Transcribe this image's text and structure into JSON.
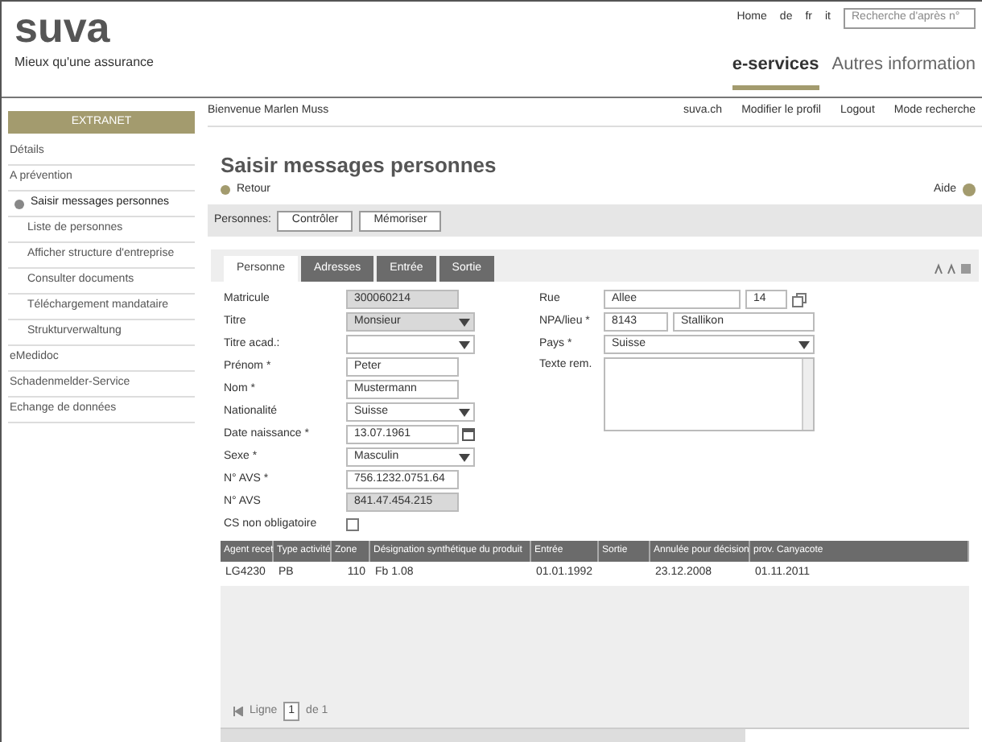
{
  "header": {
    "logo": "suva",
    "tagline": "Mieux qu'une assurance",
    "top_links": [
      "Home",
      "de",
      "fr",
      "it"
    ],
    "search": {
      "placeholder": "Recherche d'après n°"
    },
    "nav": [
      {
        "label": "e-services",
        "selected": true
      },
      {
        "label": "Autres information",
        "selected": false
      }
    ]
  },
  "sidebar": {
    "button": "EXTRANET",
    "items": [
      {
        "label": "Détails",
        "kind": "section",
        "selected": false
      },
      {
        "label": "A prévention",
        "kind": "section",
        "selected": false
      },
      {
        "label": "Saisir messages personnes",
        "kind": "sub",
        "selected": true
      },
      {
        "label": "Liste de personnes",
        "kind": "sub",
        "selected": false
      },
      {
        "label": "Afficher structure d'entreprise",
        "kind": "sub",
        "selected": false
      },
      {
        "label": "Consulter documents",
        "kind": "sub",
        "selected": false
      },
      {
        "label": "Téléchargement mandataire",
        "kind": "sub",
        "selected": false
      },
      {
        "label": "Strukturverwaltung",
        "kind": "sub",
        "selected": false
      },
      {
        "label": "eMedidoc",
        "kind": "section",
        "selected": false
      },
      {
        "label": "Schadenmelder-Service",
        "kind": "section",
        "selected": false
      },
      {
        "label": "Echange de données",
        "kind": "section",
        "selected": false
      }
    ]
  },
  "topbar": {
    "welcome": "Bienvenue Marlen Muss",
    "links": [
      "suva.ch",
      "Modifier le profil",
      "Logout",
      "Mode recherche"
    ]
  },
  "page": {
    "title": "Saisir messages personnes",
    "back": "Retour",
    "help": "Aide"
  },
  "toolbar": {
    "label": "Personnes:",
    "buttons": [
      "Contrôler",
      "Mémoriser"
    ]
  },
  "tabs": [
    {
      "label": "Personne",
      "selected": true
    },
    {
      "label": "Adresses",
      "selected": false
    },
    {
      "label": "Entrée",
      "selected": false
    },
    {
      "label": "Sortie",
      "selected": false
    }
  ],
  "form_left": [
    {
      "label": "Matricule",
      "kind": "readonly",
      "value": "300060214"
    },
    {
      "label": "Titre",
      "kind": "select",
      "value": "Monsieur",
      "disabled": true
    },
    {
      "label": "Titre acad.:",
      "kind": "select",
      "disabled": false
    },
    {
      "label": "Prénom *",
      "kind": "text",
      "value": "Peter"
    },
    {
      "label": "Nom *",
      "kind": "text",
      "value": "Mustermann"
    },
    {
      "label": "Nationalité",
      "kind": "select",
      "value": "Suisse",
      "disabled": false
    },
    {
      "label": "Date naissance *",
      "kind": "date",
      "value": "13.07.1961"
    },
    {
      "label": "Sexe *",
      "kind": "select",
      "value": "Masculin",
      "disabled": false
    },
    {
      "label": "N° AVS *",
      "kind": "text",
      "value": "756.1232.0751.64"
    },
    {
      "label": "N° AVS",
      "kind": "readonly",
      "value": "841.47.454.215"
    },
    {
      "label": "CS non obligatoire",
      "kind": "checkbox",
      "checked": false
    }
  ],
  "form_right": {
    "street": {
      "label": "Rue",
      "value": "Allee",
      "number": "14"
    },
    "zip": {
      "label": "NPA/lieu *",
      "zip": "8143",
      "city": "Stallikon"
    },
    "country": {
      "label": "Pays *",
      "value": "Suisse"
    },
    "remark": {
      "label": "Texte rem."
    }
  },
  "table": {
    "columns": [
      "Agent recet",
      "Type activité",
      "Zone",
      "Désignation synthétique du produit",
      "Entrée",
      "Sortie",
      "Annulée pour décision",
      "prov. Canyacote"
    ],
    "rows": [
      [
        "LG4230",
        "PB",
        "110",
        "Fb 1.08",
        "01.01.1992",
        null,
        "23.12.2008",
        "01.11.2011"
      ]
    ]
  },
  "pager": {
    "label": "Ligne",
    "value": "1",
    "of": "de 1"
  }
}
